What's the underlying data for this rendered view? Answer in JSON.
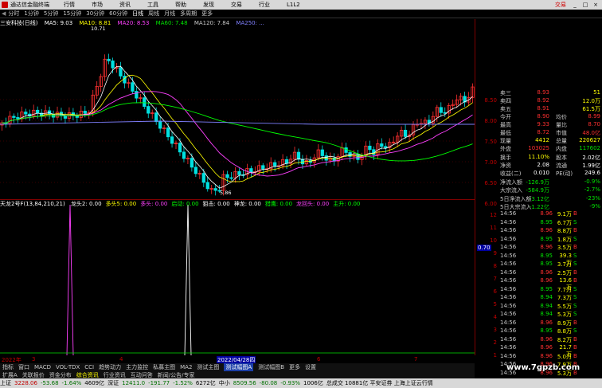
{
  "menu": {
    "app_name": "通达信金融终端",
    "items": [
      "行情",
      "市场",
      "资讯",
      "工具",
      "帮助",
      "发现",
      "交易",
      "行业",
      "L1L2"
    ],
    "trade": "交易",
    "window_buttons": [
      "_",
      "□",
      "×"
    ]
  },
  "periods": [
    "分时",
    "1分钟",
    "5分钟",
    "15分钟",
    "30分钟",
    "60分钟",
    "日线",
    "周线",
    "月线",
    "多周期",
    "更多"
  ],
  "active_period": "日线",
  "stock_info": {
    "name": "三安科技(日线)",
    "ma5": "MA5: 9.03",
    "ma10": "MA10: 8.81",
    "ma20": "MA20: 8.53",
    "ma60": "MA60: 7.48",
    "ma120": "MA120: 7.84",
    "ma250": "MA250: ...",
    "high_mark": "10.71",
    "low_mark": "5.86"
  },
  "indicator_info": {
    "name": "天龙2号F(13,84,210,21)",
    "fields": [
      {
        "label": "龙头2: 0.00",
        "color": "#ffffff"
      },
      {
        "label": "多头5: 0.00",
        "color": "#ffff00"
      },
      {
        "label": "多头: 0.00",
        "color": "#ff40ff"
      },
      {
        "label": "启动: 0.00",
        "color": "#00ff00"
      },
      {
        "label": "狙击: 0.00",
        "color": "#ffffff"
      },
      {
        "label": "神龙: 0.00",
        "color": "#ffffff"
      },
      {
        "label": "猎鹰: 0.00",
        "color": "#00ff00"
      },
      {
        "label": "龙回头: 0.00",
        "color": "#ff40ff"
      },
      {
        "label": "主升: 0.00",
        "color": "#00ff00"
      }
    ]
  },
  "indicator_spikes": {
    "label": "0.70"
  },
  "main_axis_ticks": [
    "8.50",
    "8.00",
    "7.50",
    "7.00",
    "6.50",
    "6.00"
  ],
  "ind_axis_ticks": [
    "12",
    "11",
    "10",
    "9",
    "8",
    "7",
    "6",
    "5",
    "4",
    "3",
    "2",
    "1"
  ],
  "date_axis": [
    {
      "label": "2022年",
      "sel": false
    },
    {
      "label": "3",
      "sel": false
    },
    {
      "label": "4",
      "sel": false
    },
    {
      "label": "2022/04/28四",
      "sel": true
    },
    {
      "label": "6",
      "sel": false
    },
    {
      "label": "7",
      "sel": false
    }
  ],
  "tabs_row1": [
    {
      "label": "指标",
      "hl": false,
      "sel": false
    },
    {
      "label": "窗口",
      "hl": false,
      "sel": false
    },
    {
      "label": "MACD",
      "hl": false,
      "sel": false
    },
    {
      "label": "VOL-TDX",
      "hl": false,
      "sel": false
    },
    {
      "label": "CCI",
      "hl": false,
      "sel": false
    },
    {
      "label": "趋势动力",
      "hl": false,
      "sel": false
    },
    {
      "label": "主力监控",
      "hl": false,
      "sel": false
    },
    {
      "label": "私募主图",
      "hl": false,
      "sel": false
    },
    {
      "label": "MA2",
      "hl": false,
      "sel": false
    },
    {
      "label": "测试主图",
      "hl": false,
      "sel": false
    },
    {
      "label": "测试幅图A",
      "hl": false,
      "sel": true
    },
    {
      "label": "测试幅图B",
      "hl": false,
      "sel": false
    },
    {
      "label": "更多",
      "hl": false,
      "sel": false
    },
    {
      "label": "设置",
      "hl": false,
      "sel": false
    }
  ],
  "tabs_row2": [
    {
      "label": "扩展A",
      "hl": false
    },
    {
      "label": "关联报价",
      "hl": false
    },
    {
      "label": "资金分布",
      "hl": false
    },
    {
      "label": "综合资讯",
      "hl": true
    },
    {
      "label": "行业资讯",
      "hl": false
    },
    {
      "label": "互动问答",
      "hl": false
    },
    {
      "label": "新闻/公告/专家",
      "hl": false
    }
  ],
  "quote_rows": [
    {
      "k": "卖三",
      "v1": "8.93",
      "k2": "",
      "v2": "51",
      "c1": "red",
      "c2": "yellow"
    },
    {
      "k": "卖四",
      "v1": "8.92",
      "k2": "",
      "v2": "12.0万",
      "c1": "red",
      "c2": "yellow"
    },
    {
      "k": "卖五",
      "v1": "8.91",
      "k2": "",
      "v2": "61.5万",
      "c1": "red",
      "c2": "yellow"
    },
    {
      "k": "今开",
      "v1": "8.90",
      "k2": "均价",
      "v2": "8.99",
      "c1": "red",
      "c2": "red"
    },
    {
      "k": "最高",
      "v1": "9.33",
      "k2": "量比",
      "v2": "8.70",
      "c1": "red",
      "c2": "red"
    },
    {
      "k": "最低",
      "v1": "8.72",
      "k2": "市值",
      "v2": "48.0亿",
      "c1": "red",
      "c2": "red"
    },
    {
      "k": "现量",
      "v1": "4412",
      "k2": "总量",
      "v2": "220627",
      "c1": "yellow",
      "c2": "yellow"
    },
    {
      "k": "外盘",
      "v1": "103025",
      "k2": "内盘",
      "v2": "117602",
      "c1": "red",
      "c2": "green"
    },
    {
      "k": "换手",
      "v1": "11.10%",
      "k2": "股本",
      "v2": "2.02亿",
      "c1": "yellow",
      "c2": "white"
    },
    {
      "k": "净资",
      "v1": "2.08",
      "k2": "流通",
      "v2": "1.99亿",
      "c1": "white",
      "c2": "white"
    },
    {
      "k": "收益(二)",
      "v1": "0.010",
      "k2": "PE(动)",
      "v2": "249.6",
      "c1": "white",
      "c2": "white"
    },
    {
      "k": "净流入额",
      "v1": "-126.9万",
      "k2": "",
      "v2": "-0.9%",
      "c1": "green",
      "c2": "green"
    },
    {
      "k": "大宗流入",
      "v1": "-584.9万",
      "k2": "",
      "v2": "-2.7%",
      "c1": "green",
      "c2": "green"
    },
    {
      "k": "5日净流入额",
      "v1": "-3.12亿",
      "k2": "",
      "v2": "-23%",
      "c1": "green",
      "c2": "green"
    },
    {
      "k": "5日大宗流入",
      "v1": "-1.22亿",
      "k2": "",
      "v2": "-9%",
      "c1": "green",
      "c2": "green"
    }
  ],
  "ticks": [
    {
      "t": "14:56",
      "p": "8.96",
      "v": "9.1万",
      "d": "B"
    },
    {
      "t": "14:56",
      "p": "8.95",
      "v": "6.7万",
      "d": "S"
    },
    {
      "t": "14:56",
      "p": "8.96",
      "v": "8.8万",
      "d": "B"
    },
    {
      "t": "14:56",
      "p": "8.95",
      "v": "1.8万",
      "d": "S"
    },
    {
      "t": "14:56",
      "p": "8.96",
      "v": "3.5万",
      "d": "B"
    },
    {
      "t": "14:56",
      "p": "8.95",
      "v": "39.3万",
      "d": "S"
    },
    {
      "t": "14:56",
      "p": "8.95",
      "v": "3.7万",
      "d": "S"
    },
    {
      "t": "14:56",
      "p": "8.96",
      "v": "2.5万",
      "d": "B"
    },
    {
      "t": "14:56",
      "p": "8.96",
      "v": "13.6万",
      "d": "B"
    },
    {
      "t": "14:56",
      "p": "8.95",
      "v": "7.7万",
      "d": "S"
    },
    {
      "t": "14:56",
      "p": "8.94",
      "v": "7.3万",
      "d": "S"
    },
    {
      "t": "14:56",
      "p": "8.94",
      "v": "5.5万",
      "d": "S"
    },
    {
      "t": "14:56",
      "p": "8.94",
      "v": "5.3万",
      "d": "S"
    },
    {
      "t": "14:56",
      "p": "8.96",
      "v": "8.9万",
      "d": "B"
    },
    {
      "t": "14:56",
      "p": "8.95",
      "v": "8.8万",
      "d": "S"
    },
    {
      "t": "14:56",
      "p": "8.96",
      "v": "8.2万",
      "d": "B"
    },
    {
      "t": "14:56",
      "p": "8.96",
      "v": "21.7万",
      "d": "B"
    },
    {
      "t": "14:56",
      "p": "8.96",
      "v": "5.0万",
      "d": "B"
    },
    {
      "t": "14:56",
      "p": "8.96",
      "v": "7.9万",
      "d": "B"
    },
    {
      "t": "14:56",
      "p": "8.96",
      "v": "5.3万",
      "d": "B"
    }
  ],
  "status": {
    "sh_label": "上证",
    "sh_value": "3228.06",
    "sh_change": "-53.68",
    "sh_pct": "-1.64%",
    "sh_amount": "4609亿",
    "sz_label": "深证",
    "sz_value": "12411.0",
    "sz_change": "-191.77",
    "sz_pct": "-1.52%",
    "sz_amount": "6272亿",
    "zx_label": "中小",
    "zx_value": "8509.56",
    "zx_change": "-80.08",
    "zx_pct": "-0.93%",
    "zx_amount": "1006亿",
    "news": "总成交 10881亿 平安证券 上海上证云行情"
  },
  "watermark": "www.7gpzb.com",
  "colors": {
    "up": "#ff3030",
    "down": "#00e0e0",
    "ma5": "#ffffff",
    "ma10": "#ffff00",
    "ma20": "#ff40ff",
    "ma60": "#00ff00",
    "ma120": "#8080ff"
  }
}
